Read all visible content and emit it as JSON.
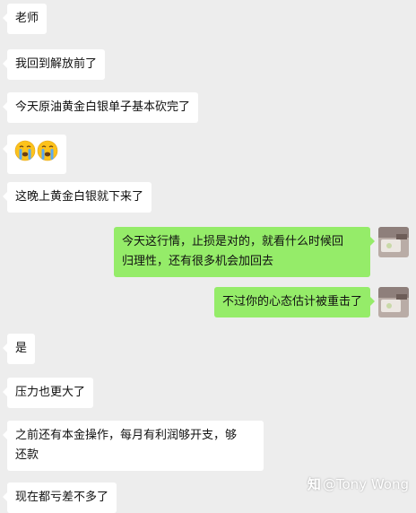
{
  "messages": [
    {
      "side": "left",
      "text": "老师"
    },
    {
      "side": "left",
      "text": "我回到解放前了"
    },
    {
      "side": "left",
      "text": "今天原油黄金白银单子基本砍完了"
    },
    {
      "side": "left",
      "emoji": [
        "crying-face",
        "crying-face"
      ]
    },
    {
      "side": "left",
      "text": "这晚上黄金白银就下来了"
    },
    {
      "side": "right",
      "lines": [
        "今天这行情，止损是对的，就看什么时候回",
        "归理性，还有很多机会加回去"
      ]
    },
    {
      "side": "right",
      "text": "不过你的心态估计被重击了"
    },
    {
      "side": "left",
      "text": "是"
    },
    {
      "side": "left",
      "text": "压力也更大了"
    },
    {
      "side": "left",
      "lines": [
        "之前还有本金操作，每月有利润够开支，够",
        "还款"
      ]
    },
    {
      "side": "left",
      "text": "现在都亏差不多了"
    }
  ],
  "watermark": {
    "logo": "知",
    "text": "@Tony Wong"
  },
  "colors": {
    "background": "#ededed",
    "incoming": "#ffffff",
    "outgoing": "#95ec69"
  }
}
